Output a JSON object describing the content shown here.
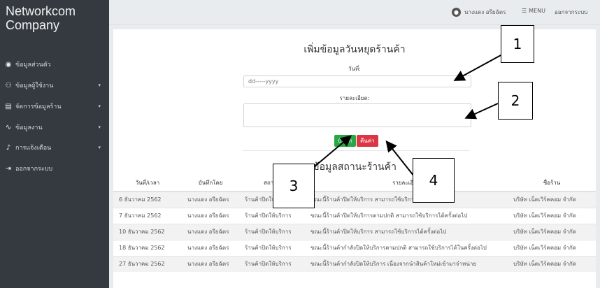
{
  "sidebar": {
    "brand": "Networkcom Company",
    "items": [
      {
        "icon": "user-circle-icon",
        "glyph": "◉",
        "label": "ข้อมูลส่วนตัว",
        "caret": false
      },
      {
        "icon": "users-icon",
        "glyph": "⚇",
        "label": "ข้อมูลผู้ใช้งาน",
        "caret": true
      },
      {
        "icon": "file-icon",
        "glyph": "▤",
        "label": "จัดการข้อมูลร้าน",
        "caret": true
      },
      {
        "icon": "line-chart-icon",
        "glyph": "∿",
        "label": "ข้อมูลงาน",
        "caret": true
      },
      {
        "icon": "bell-icon",
        "glyph": "♪",
        "label": "การแจ้งเตือน",
        "caret": true
      },
      {
        "icon": "sign-out-icon",
        "glyph": "⇥",
        "label": "ออกจากระบบ",
        "caret": false
      }
    ]
  },
  "topbar": {
    "user_name": "นางแดง อรียฉัตร",
    "menu_label": "MENU",
    "logout_label": "ออกจากระบบ"
  },
  "form": {
    "title": "เพิ่มข้อมูลวันหยุดร้านค้า",
    "date_label": "วันที่:",
    "date_placeholder": "dd-----yyyy",
    "detail_label": "รายละเอียด:",
    "save_label": "บันทึก",
    "reset_label": "คืนค่า"
  },
  "table": {
    "title": "ข้อมูลสถานะร้านค้า",
    "headers": [
      "วันที่/เวลา",
      "บันทึกโดย",
      "สถานะ",
      "รายละเอียด",
      "ชื่อร้าน"
    ],
    "rows": [
      [
        "6 ธันวาคม 2562",
        "นางแดง อรียฉัตร",
        "ร้านค้าปิดให้บริการ",
        "ขณะนี้ร้านค้าปิดให้บริการ สามารถใช้บริการได้ครั้งต่อไป",
        "บริษัท เน็ตเวิร์คคอม จำกัด"
      ],
      [
        "7 ธันวาคม 2562",
        "นางแดง อรียฉัตร",
        "ร้านค้าปิดให้บริการ",
        "ขณะนี้ร้านค้าปิดให้บริการตามปกติ สามารถใช้บริการได้ครั้งต่อไป",
        "บริษัท เน็ตเวิร์คคอม จำกัด"
      ],
      [
        "10 ธันวาคม 2562",
        "นางแดง อรียฉัตร",
        "ร้านค้าปิดให้บริการ",
        "ขณะนี้ร้านค้าปิดให้บริการ สามารถใช้บริการได้ครั้งต่อไป",
        "บริษัท เน็ตเวิร์คคอม จำกัด"
      ],
      [
        "18 ธันวาคม 2562",
        "นางแดง อรียฉัตร",
        "ร้านค้าปิดให้บริการ",
        "ขณะนี้ร้านค้ากำลังปิดให้บริการตามปกติ สามารถใช้บริการได้ในครั้งต่อไป",
        "บริษัท เน็ตเวิร์คคอม จำกัด"
      ],
      [
        "27 ธันวาคม 2562",
        "นางแดง อรียฉัตร",
        "ร้านค้าปิดให้บริการ",
        "ขณะนี้ร้านค้ากำลังปิดให้บริการ เนื่องจากนำสินค้าใหม่เข้ามาจำหน่าย",
        "บริษัท เน็ตเวิร์คคอม จำกัด"
      ]
    ]
  },
  "callouts": [
    "1",
    "2",
    "3",
    "4"
  ]
}
